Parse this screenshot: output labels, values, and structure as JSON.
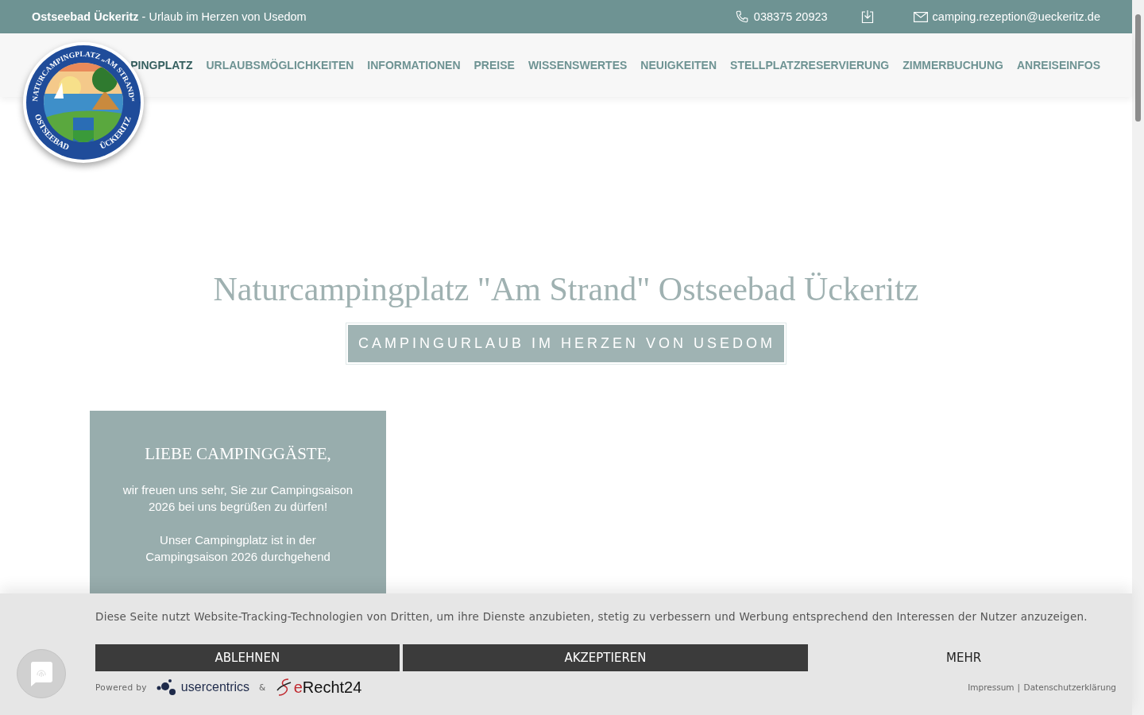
{
  "top_bar": {
    "site_name": "Ostseebad Ückeritz",
    "tagline": "- Urlaub im Herzen von Usedom",
    "phone": "038375 20923",
    "email": "camping.rezeption@ueckeritz.de"
  },
  "logo": {
    "top_text": "NATURCAMPINGPLATZ „AM STRAND“",
    "bottom_left": "OSTSEEBAD",
    "bottom_right": "ÜCKERITZ"
  },
  "nav": [
    {
      "label": "PINGPLATZ",
      "selected": true
    },
    {
      "label": "URLAUBSMÖGLICHKEITEN",
      "selected": false
    },
    {
      "label": "INFORMATIONEN",
      "selected": false
    },
    {
      "label": "PREISE",
      "selected": false
    },
    {
      "label": "WISSENSWERTES",
      "selected": false
    },
    {
      "label": "NEUIGKEITEN",
      "selected": false
    },
    {
      "label": "STELLPLATZRESERVIERUNG",
      "selected": false
    },
    {
      "label": "ZIMMERBUCHUNG",
      "selected": false
    },
    {
      "label": "ANREISEINFOS",
      "selected": false
    }
  ],
  "hero": {
    "title": "Naturcampingplatz \"Am Strand\" Ostseebad Ückeritz",
    "subtitle": "CAMPINGURLAUB IM HERZEN VON USEDOM"
  },
  "card": {
    "title": "LIEBE CAMPINGGÄSTE,",
    "paragraphs": [
      "wir freuen uns sehr, Sie zur Campingsaison 2026 bei uns begrüßen zu dürfen!",
      "Unser Campingplatz ist in der Campingsaison 2026 durchgehend"
    ]
  },
  "cookie_banner": {
    "message": "Diese Seite nutzt Website-Tracking-Technologien von Dritten, um ihre Dienste anzubieten, stetig zu verbessern und Werbung entsprechend den Interessen der Nutzer anzuzeigen.",
    "buttons": [
      {
        "label": "ABLEHNEN",
        "kind": "dark"
      },
      {
        "label": "AKZEPTIEREN",
        "kind": "dark"
      },
      {
        "label": "MEHR",
        "kind": "plain"
      }
    ],
    "powered_by": "Powered by",
    "brand_1": "usercentrics",
    "ampersand": "&",
    "brand_2_mark": "e",
    "brand_2": "Recht24",
    "links": [
      "Impressum",
      "Datenschutzerklärung"
    ],
    "separator": "|"
  }
}
